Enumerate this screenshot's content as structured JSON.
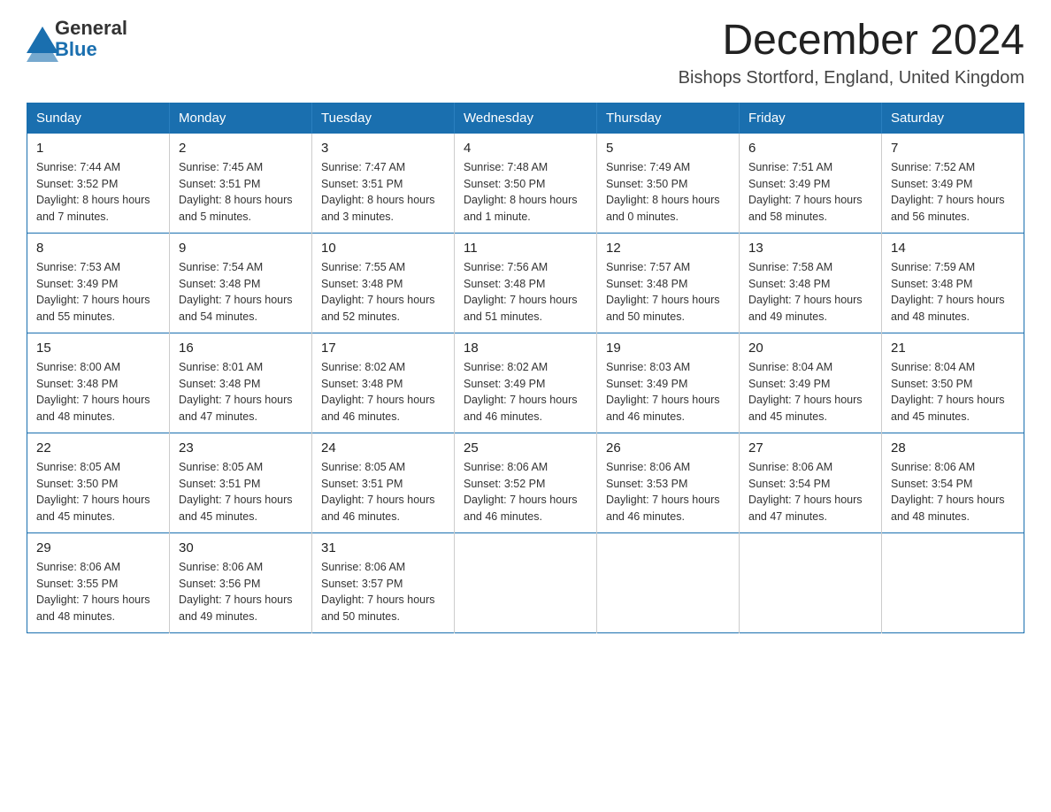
{
  "header": {
    "logo": {
      "general": "General",
      "blue": "Blue",
      "icon_shape": "triangle"
    },
    "title": "December 2024",
    "subtitle": "Bishops Stortford, England, United Kingdom"
  },
  "calendar": {
    "days_of_week": [
      "Sunday",
      "Monday",
      "Tuesday",
      "Wednesday",
      "Thursday",
      "Friday",
      "Saturday"
    ],
    "weeks": [
      [
        {
          "day": "1",
          "sunrise": "7:44 AM",
          "sunset": "3:52 PM",
          "daylight": "8 hours and 7 minutes."
        },
        {
          "day": "2",
          "sunrise": "7:45 AM",
          "sunset": "3:51 PM",
          "daylight": "8 hours and 5 minutes."
        },
        {
          "day": "3",
          "sunrise": "7:47 AM",
          "sunset": "3:51 PM",
          "daylight": "8 hours and 3 minutes."
        },
        {
          "day": "4",
          "sunrise": "7:48 AM",
          "sunset": "3:50 PM",
          "daylight": "8 hours and 1 minute."
        },
        {
          "day": "5",
          "sunrise": "7:49 AM",
          "sunset": "3:50 PM",
          "daylight": "8 hours and 0 minutes."
        },
        {
          "day": "6",
          "sunrise": "7:51 AM",
          "sunset": "3:49 PM",
          "daylight": "7 hours and 58 minutes."
        },
        {
          "day": "7",
          "sunrise": "7:52 AM",
          "sunset": "3:49 PM",
          "daylight": "7 hours and 56 minutes."
        }
      ],
      [
        {
          "day": "8",
          "sunrise": "7:53 AM",
          "sunset": "3:49 PM",
          "daylight": "7 hours and 55 minutes."
        },
        {
          "day": "9",
          "sunrise": "7:54 AM",
          "sunset": "3:48 PM",
          "daylight": "7 hours and 54 minutes."
        },
        {
          "day": "10",
          "sunrise": "7:55 AM",
          "sunset": "3:48 PM",
          "daylight": "7 hours and 52 minutes."
        },
        {
          "day": "11",
          "sunrise": "7:56 AM",
          "sunset": "3:48 PM",
          "daylight": "7 hours and 51 minutes."
        },
        {
          "day": "12",
          "sunrise": "7:57 AM",
          "sunset": "3:48 PM",
          "daylight": "7 hours and 50 minutes."
        },
        {
          "day": "13",
          "sunrise": "7:58 AM",
          "sunset": "3:48 PM",
          "daylight": "7 hours and 49 minutes."
        },
        {
          "day": "14",
          "sunrise": "7:59 AM",
          "sunset": "3:48 PM",
          "daylight": "7 hours and 48 minutes."
        }
      ],
      [
        {
          "day": "15",
          "sunrise": "8:00 AM",
          "sunset": "3:48 PM",
          "daylight": "7 hours and 48 minutes."
        },
        {
          "day": "16",
          "sunrise": "8:01 AM",
          "sunset": "3:48 PM",
          "daylight": "7 hours and 47 minutes."
        },
        {
          "day": "17",
          "sunrise": "8:02 AM",
          "sunset": "3:48 PM",
          "daylight": "7 hours and 46 minutes."
        },
        {
          "day": "18",
          "sunrise": "8:02 AM",
          "sunset": "3:49 PM",
          "daylight": "7 hours and 46 minutes."
        },
        {
          "day": "19",
          "sunrise": "8:03 AM",
          "sunset": "3:49 PM",
          "daylight": "7 hours and 46 minutes."
        },
        {
          "day": "20",
          "sunrise": "8:04 AM",
          "sunset": "3:49 PM",
          "daylight": "7 hours and 45 minutes."
        },
        {
          "day": "21",
          "sunrise": "8:04 AM",
          "sunset": "3:50 PM",
          "daylight": "7 hours and 45 minutes."
        }
      ],
      [
        {
          "day": "22",
          "sunrise": "8:05 AM",
          "sunset": "3:50 PM",
          "daylight": "7 hours and 45 minutes."
        },
        {
          "day": "23",
          "sunrise": "8:05 AM",
          "sunset": "3:51 PM",
          "daylight": "7 hours and 45 minutes."
        },
        {
          "day": "24",
          "sunrise": "8:05 AM",
          "sunset": "3:51 PM",
          "daylight": "7 hours and 46 minutes."
        },
        {
          "day": "25",
          "sunrise": "8:06 AM",
          "sunset": "3:52 PM",
          "daylight": "7 hours and 46 minutes."
        },
        {
          "day": "26",
          "sunrise": "8:06 AM",
          "sunset": "3:53 PM",
          "daylight": "7 hours and 46 minutes."
        },
        {
          "day": "27",
          "sunrise": "8:06 AM",
          "sunset": "3:54 PM",
          "daylight": "7 hours and 47 minutes."
        },
        {
          "day": "28",
          "sunrise": "8:06 AM",
          "sunset": "3:54 PM",
          "daylight": "7 hours and 48 minutes."
        }
      ],
      [
        {
          "day": "29",
          "sunrise": "8:06 AM",
          "sunset": "3:55 PM",
          "daylight": "7 hours and 48 minutes."
        },
        {
          "day": "30",
          "sunrise": "8:06 AM",
          "sunset": "3:56 PM",
          "daylight": "7 hours and 49 minutes."
        },
        {
          "day": "31",
          "sunrise": "8:06 AM",
          "sunset": "3:57 PM",
          "daylight": "7 hours and 50 minutes."
        },
        null,
        null,
        null,
        null
      ]
    ]
  },
  "labels": {
    "sunrise": "Sunrise:",
    "sunset": "Sunset:",
    "daylight": "Daylight:"
  }
}
